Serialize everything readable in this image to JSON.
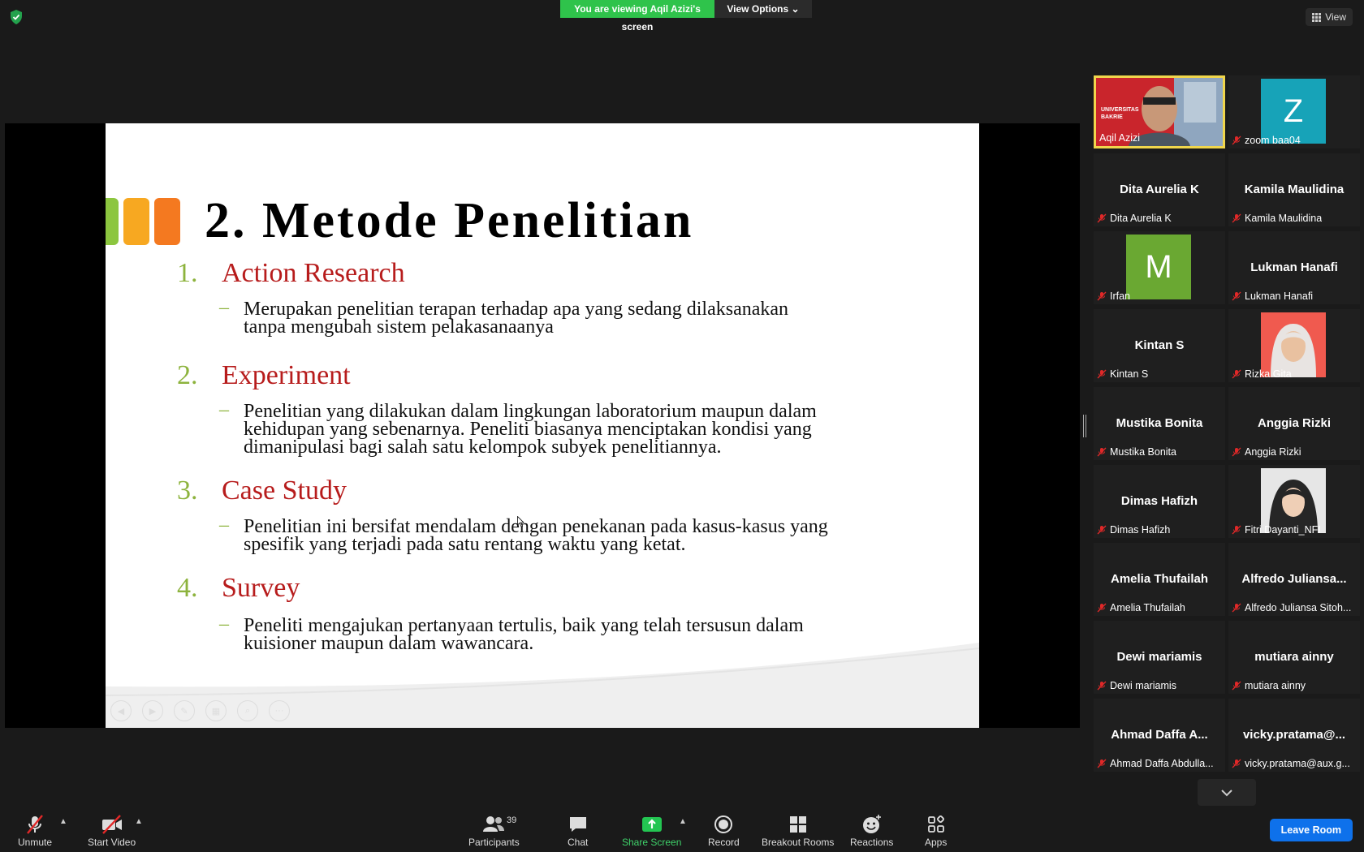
{
  "banner": {
    "viewing": "You are viewing Aqil Azizi's screen",
    "view_options": "View Options"
  },
  "top_view": "View",
  "slide": {
    "title": "2. Metode Penelitian",
    "items": [
      {
        "num": "1.",
        "head": "Action Research",
        "dash": "–",
        "lines": [
          "Merupakan penelitian terapan terhadap apa yang sedang dilaksanakan",
          "tanpa mengubah sistem pelakasanaanya"
        ]
      },
      {
        "num": "2.",
        "head": "Experiment",
        "dash": "–",
        "lines": [
          "Penelitian yang dilakukan dalam lingkungan laboratorium maupun dalam",
          "kehidupan yang sebenarnya. Peneliti biasanya menciptakan kondisi yang",
          "dimanipulasi bagi salah satu kelompok subyek penelitiannya."
        ]
      },
      {
        "num": "3.",
        "head": "Case Study",
        "dash": "–",
        "lines": [
          "Penelitian ini bersifat mendalam dengan penekanan pada kasus-kasus yang",
          "spesifik yang terjadi pada satu rentang waktu yang ketat."
        ]
      },
      {
        "num": "4.",
        "head": "Survey",
        "dash": "–",
        "lines": [
          "Peneliti mengajukan pertanyaan tertulis, baik yang telah tersusun dalam",
          "kuisioner maupun dalam wawancara."
        ]
      }
    ],
    "square_colors": [
      "#8cc63f",
      "#f7a821",
      "#f47920"
    ]
  },
  "gallery": [
    {
      "label": "Aqil Azizi",
      "type": "video"
    },
    {
      "label": "zoom baa04",
      "type": "letter",
      "letter": "Z",
      "color": "#17a3b8"
    },
    {
      "name": "Dita Aurelia K",
      "label": "Dita Aurelia K"
    },
    {
      "name": "Kamila Maulidina",
      "label": "Kamila Maulidina"
    },
    {
      "label": "Irfan",
      "type": "letter",
      "letter": "M",
      "color": "#6aa832"
    },
    {
      "name": "Lukman Hanafi",
      "label": "Lukman Hanafi"
    },
    {
      "name": "Kintan S",
      "label": "Kintan S"
    },
    {
      "label": "Rizka Gita",
      "type": "photo"
    },
    {
      "name": "Mustika Bonita",
      "label": "Mustika Bonita"
    },
    {
      "name": "Anggia Rizki",
      "label": "Anggia Rizki"
    },
    {
      "name": "Dimas Hafizh",
      "label": "Dimas Hafizh"
    },
    {
      "label": "Fitri Dayanti_NFI",
      "type": "photo2"
    },
    {
      "name": "Amelia Thufailah",
      "label": "Amelia Thufailah"
    },
    {
      "name": "Alfredo Juliansa...",
      "label": "Alfredo Juliansa Sitoh..."
    },
    {
      "name": "Dewi mariamis",
      "label": "Dewi mariamis"
    },
    {
      "name": "mutiara ainny",
      "label": "mutiara ainny"
    },
    {
      "name": "Ahmad Daffa A...",
      "label": "Ahmad Daffa Abdulla..."
    },
    {
      "name": "vicky.pratama@...",
      "label": "vicky.pratama@aux.g..."
    }
  ],
  "video_overlay": {
    "line1": "UNIVERSITAS",
    "line2": "BAKRIE"
  },
  "toolbar": {
    "unmute": "Unmute",
    "start_video": "Start Video",
    "participants": "Participants",
    "participants_count": "39",
    "chat": "Chat",
    "share_screen": "Share Screen",
    "record": "Record",
    "breakout": "Breakout Rooms",
    "reactions": "Reactions",
    "apps": "Apps",
    "leave": "Leave Room"
  }
}
